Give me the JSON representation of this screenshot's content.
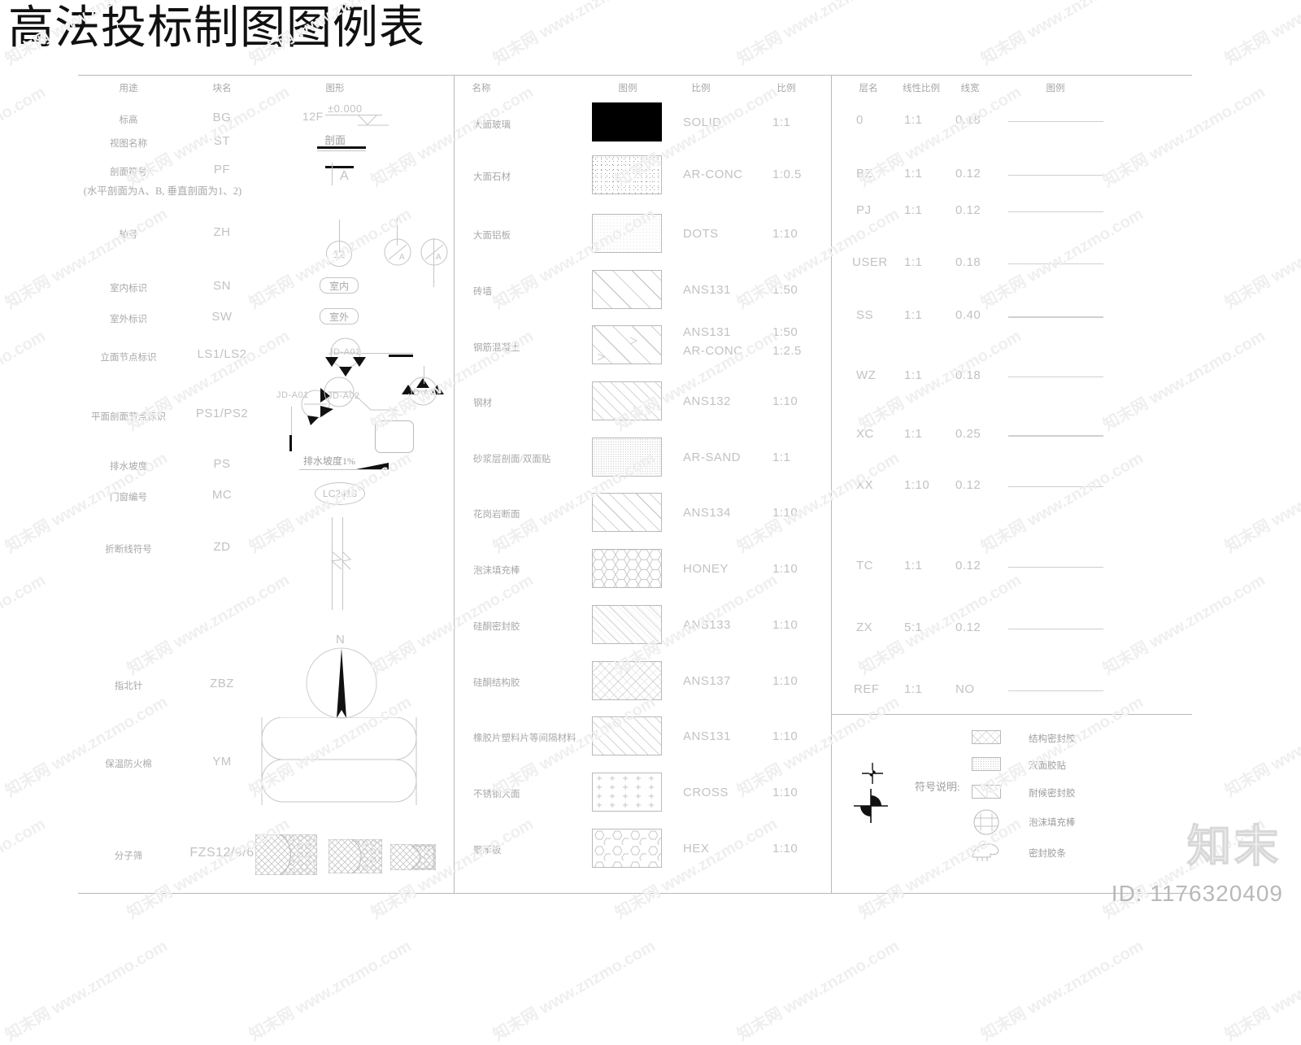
{
  "title": "高法投标制图图例表",
  "watermark": {
    "tile_text": "知末网 www.znzmo.com",
    "brand": "知末",
    "id_label": "ID: 1176320409"
  },
  "blocks_table": {
    "headers": [
      "用途",
      "块名",
      "图形"
    ],
    "rows": [
      {
        "use": "标高",
        "block": "BG",
        "graphic": "12F ±0.000"
      },
      {
        "use": "视图名称",
        "block": "ST",
        "graphic": "剖面"
      },
      {
        "use": "剖面符号",
        "block": "PF",
        "note": "(水平剖面为A、B, 垂直剖面为1、2)",
        "graphic": "A"
      },
      {
        "use": "轴号",
        "block": "ZH",
        "graphic": "12"
      },
      {
        "use": "室内标识",
        "block": "SN",
        "graphic": "室内"
      },
      {
        "use": "室外标识",
        "block": "SW",
        "graphic": "室外"
      },
      {
        "use": "立面节点标识",
        "block": "LS1/LS2",
        "graphic": "JD-A01"
      },
      {
        "use": "平面剖面节点标识",
        "block": "PS1/PS2",
        "graphic": "JD-A01 / JD-A02"
      },
      {
        "use": "排水坡度",
        "block": "PS",
        "graphic": "排水坡度1%"
      },
      {
        "use": "门窗编号",
        "block": "MC",
        "graphic": "LC2418"
      },
      {
        "use": "折断线符号",
        "block": "ZD",
        "graphic": ""
      },
      {
        "use": "指北针",
        "block": "ZBZ",
        "graphic": "N"
      },
      {
        "use": "保温防火棉",
        "block": "YM",
        "graphic": ""
      },
      {
        "use": "分子筛",
        "block": "FZS12/9/6",
        "graphic": ""
      }
    ],
    "symbol_labels": {
      "elevation_floor": "12F",
      "elevation_value": "±0.000",
      "section_name": "剖面",
      "section_mark": "A",
      "axis_number": "12",
      "indoor": "室内",
      "outdoor": "室外",
      "node_a01": "JD-A01",
      "node_a02": "JD-A02",
      "drain_slope": "排水坡度1%",
      "window_code": "LC2418",
      "north": "N"
    }
  },
  "materials_table": {
    "headers": [
      "名称",
      "图例",
      "比例",
      "比例"
    ],
    "rows": [
      {
        "name": "大面玻璃",
        "pattern": "solid",
        "hatch": "SOLID",
        "scale": "1:1"
      },
      {
        "name": "大面石材",
        "pattern": "arconc",
        "hatch": "AR-CONC",
        "scale": "1:0.5"
      },
      {
        "name": "大面铝板",
        "pattern": "dots",
        "hatch": "DOTS",
        "scale": "1:10"
      },
      {
        "name": "砖墙",
        "pattern": "ans131",
        "hatch": "ANS131",
        "scale": "1:50"
      },
      {
        "name": "钢筋混凝土",
        "pattern": "concrete",
        "hatch": "ANS131\nAR-CONC",
        "scale": "1:50\n1:2.5"
      },
      {
        "name": "钢材",
        "pattern": "ans132",
        "hatch": "ANS132",
        "scale": "1:10"
      },
      {
        "name": "砂浆层剖面/双面贴",
        "pattern": "arsand",
        "hatch": "AR-SAND",
        "scale": "1:1"
      },
      {
        "name": "花岗岩断面",
        "pattern": "ans134",
        "hatch": "ANS134",
        "scale": "1:10"
      },
      {
        "name": "泡沫填充棒",
        "pattern": "honey",
        "hatch": "HONEY",
        "scale": "1:10"
      },
      {
        "name": "硅酮密封胶",
        "pattern": "ans133",
        "hatch": "ANS133",
        "scale": "1:10"
      },
      {
        "name": "硅酮结构胶",
        "pattern": "ans137",
        "hatch": "ANS137",
        "scale": "1:10"
      },
      {
        "name": "橡胶片塑料片等间隔材料",
        "pattern": "ans131b",
        "hatch": "ANS131",
        "scale": "1:10"
      },
      {
        "name": "不锈钢大面",
        "pattern": "cross",
        "hatch": "CROSS",
        "scale": "1:10"
      },
      {
        "name": "聚苯板",
        "pattern": "hex",
        "hatch": "HEX",
        "scale": "1:10"
      }
    ]
  },
  "layers_table": {
    "headers": [
      "层名",
      "线性比例",
      "线宽",
      "图例"
    ],
    "rows": [
      {
        "layer": "0",
        "ltscale": "1:1",
        "lineweight": "0.18"
      },
      {
        "layer": "BZ",
        "ltscale": "1:1",
        "lineweight": "0.12"
      },
      {
        "layer": "PJ",
        "ltscale": "1:1",
        "lineweight": "0.12"
      },
      {
        "layer": "USER",
        "ltscale": "1:1",
        "lineweight": "0.18"
      },
      {
        "layer": "SS",
        "ltscale": "1:1",
        "lineweight": "0.40"
      },
      {
        "layer": "WZ",
        "ltscale": "1:1",
        "lineweight": "0.18"
      },
      {
        "layer": "XC",
        "ltscale": "1:1",
        "lineweight": "0.25"
      },
      {
        "layer": "XX",
        "ltscale": "1:10",
        "lineweight": "0.12"
      },
      {
        "layer": "TC",
        "ltscale": "1:1",
        "lineweight": "0.12"
      },
      {
        "layer": "ZX",
        "ltscale": "5:1",
        "lineweight": "0.12"
      },
      {
        "layer": "REF",
        "ltscale": "1:1",
        "lineweight": "NO"
      }
    ]
  },
  "symbol_legend": {
    "title": "符号说明:",
    "items": [
      {
        "swatch": "structural-sealant",
        "label": "结构密封胶"
      },
      {
        "swatch": "double-sided-tape",
        "label": "双面胶贴"
      },
      {
        "swatch": "weather-sealant",
        "label": "耐候密封胶"
      },
      {
        "swatch": "foam-backer-rod",
        "label": "泡沫填充棒"
      },
      {
        "swatch": "sealing-strip",
        "label": "密封胶条"
      }
    ]
  }
}
